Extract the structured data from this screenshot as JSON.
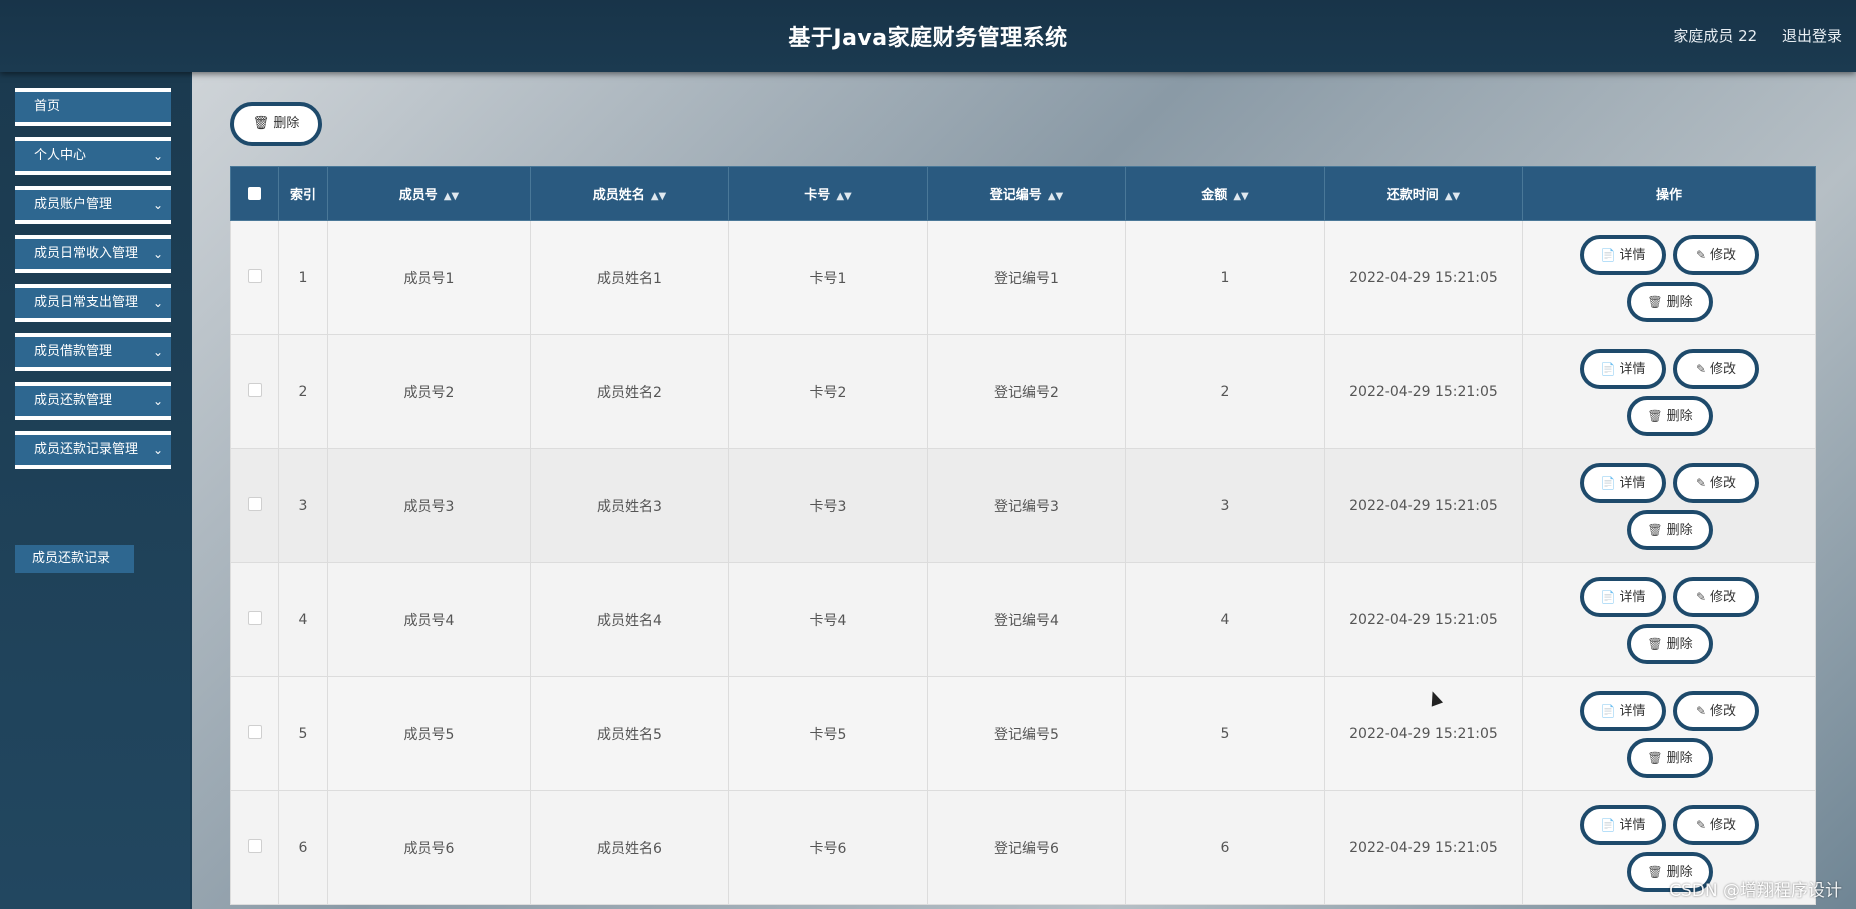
{
  "header": {
    "title": "基于Java家庭财务管理系统",
    "user": "家庭成员 22",
    "logout": "退出登录"
  },
  "sidebar": {
    "items": [
      {
        "label": "首页",
        "has_children": false
      },
      {
        "label": "个人中心",
        "has_children": true
      },
      {
        "label": "成员账户管理",
        "has_children": true
      },
      {
        "label": "成员日常收入管理",
        "has_children": true
      },
      {
        "label": "成员日常支出管理",
        "has_children": true
      },
      {
        "label": "成员借款管理",
        "has_children": true
      },
      {
        "label": "成员还款管理",
        "has_children": true
      },
      {
        "label": "成员还款记录管理",
        "has_children": true
      }
    ],
    "submenu_active": "成员还款记录"
  },
  "toolbar": {
    "delete_label": "删除"
  },
  "table": {
    "columns": [
      "索引",
      "成员号",
      "成员姓名",
      "卡号",
      "登记编号",
      "金额",
      "还款时间",
      "操作"
    ],
    "rows": [
      {
        "index": "1",
        "member_no": "成员号1",
        "member_name": "成员姓名1",
        "card_no": "卡号1",
        "reg_no": "登记编号1",
        "amount": "1",
        "time": "2022-04-29 15:21:05"
      },
      {
        "index": "2",
        "member_no": "成员号2",
        "member_name": "成员姓名2",
        "card_no": "卡号2",
        "reg_no": "登记编号2",
        "amount": "2",
        "time": "2022-04-29 15:21:05"
      },
      {
        "index": "3",
        "member_no": "成员号3",
        "member_name": "成员姓名3",
        "card_no": "卡号3",
        "reg_no": "登记编号3",
        "amount": "3",
        "time": "2022-04-29 15:21:05"
      },
      {
        "index": "4",
        "member_no": "成员号4",
        "member_name": "成员姓名4",
        "card_no": "卡号4",
        "reg_no": "登记编号4",
        "amount": "4",
        "time": "2022-04-29 15:21:05"
      },
      {
        "index": "5",
        "member_no": "成员号5",
        "member_name": "成员姓名5",
        "card_no": "卡号5",
        "reg_no": "登记编号5",
        "amount": "5",
        "time": "2022-04-29 15:21:05"
      },
      {
        "index": "6",
        "member_no": "成员号6",
        "member_name": "成员姓名6",
        "card_no": "卡号6",
        "reg_no": "登记编号6",
        "amount": "6",
        "time": "2022-04-29 15:21:05"
      }
    ],
    "actions": {
      "detail": "详情",
      "edit": "修改",
      "delete": "删除"
    }
  },
  "watermark": "CSDN @增翔程序设计"
}
